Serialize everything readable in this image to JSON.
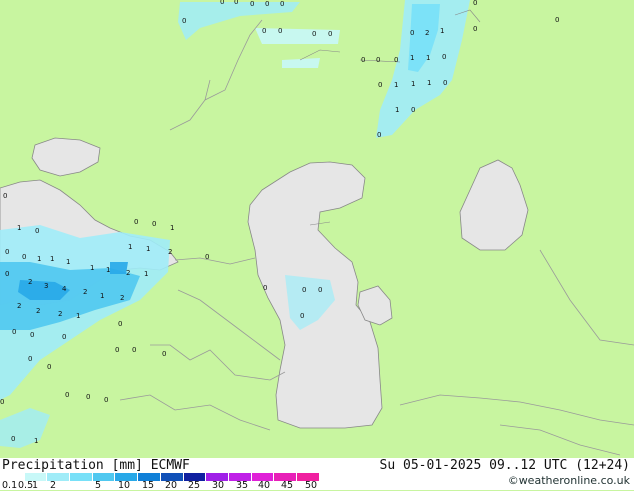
{
  "footer": {
    "title": "Precipitation [mm] ECMWF",
    "datetime": "Su 05-01-2025 09..12 UTC (12+24)",
    "credit": "©weatheronline.co.uk"
  },
  "colors": {
    "land": "#c8f5a0",
    "water": "#e6e6e6",
    "border": "#9a9a9a",
    "coast": "#888888"
  },
  "legend": {
    "ticks": [
      "0.1",
      "0.5",
      "1",
      "2",
      "5",
      "10",
      "15",
      "20",
      "25",
      "30",
      "35",
      "40",
      "45",
      "50"
    ],
    "colors": [
      "#ffffff",
      "#c8f8f8",
      "#a0ecf8",
      "#78e0f8",
      "#50c8f0",
      "#28a8e8",
      "#1080d8",
      "#1050b8",
      "#1020a0",
      "#a020e8",
      "#c020e8",
      "#e020d8",
      "#e820b8",
      "#f020a0"
    ]
  },
  "map": {
    "labels": [
      "0",
      "0",
      "0",
      "0",
      "0",
      "0",
      "0",
      "0",
      "0",
      "0",
      "0",
      "0",
      "0",
      "2",
      "1",
      "0",
      "0",
      "0",
      "0",
      "1",
      "1",
      "0",
      "0",
      "1",
      "1",
      "1",
      "0",
      "1",
      "0",
      "0",
      "0",
      "0",
      "0",
      "0",
      "0",
      "1",
      "1",
      "0",
      "1",
      "2",
      "1",
      "1",
      "0",
      "0",
      "1",
      "1",
      "1",
      "1",
      "2",
      "1",
      "3",
      "4",
      "2",
      "2",
      "1",
      "2",
      "2",
      "2",
      "2",
      "1",
      "0",
      "0",
      "0",
      "0",
      "0",
      "0",
      "0",
      "0",
      "0",
      "0",
      "0",
      "0",
      "0",
      "0",
      "0",
      "0",
      "0",
      "0",
      "1"
    ]
  }
}
